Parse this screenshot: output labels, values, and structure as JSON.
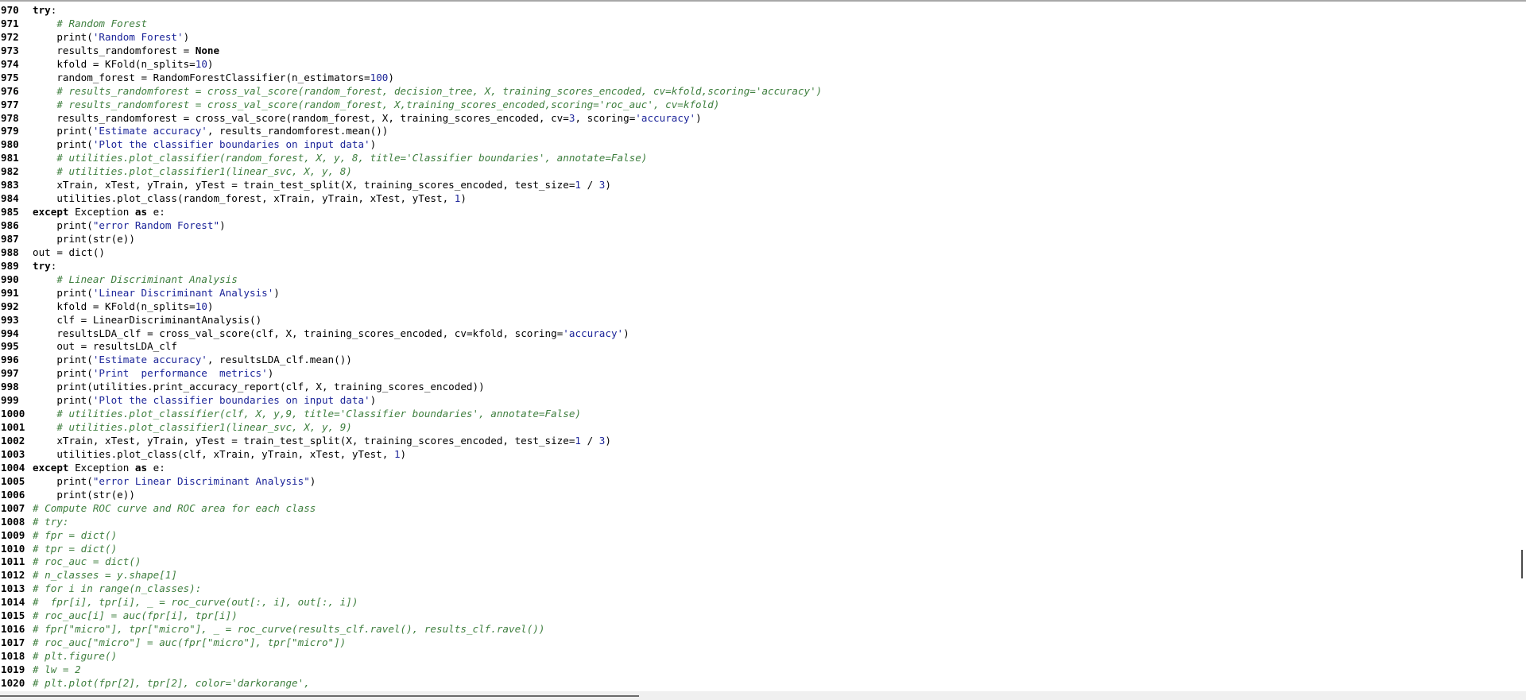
{
  "editor": {
    "lines": [
      {
        "n": "970",
        "t": [
          [
            "kw",
            "try"
          ],
          [
            "op",
            ":"
          ]
        ]
      },
      {
        "n": "971",
        "t": [
          [
            "plain",
            "    "
          ],
          [
            "cm",
            "# Random Forest"
          ]
        ]
      },
      {
        "n": "972",
        "t": [
          [
            "plain",
            "    print("
          ],
          [
            "str",
            "'Random Forest'"
          ],
          [
            "plain",
            ")"
          ]
        ]
      },
      {
        "n": "973",
        "t": [
          [
            "plain",
            "    results_randomforest "
          ],
          [
            "op",
            "="
          ],
          [
            "plain",
            " "
          ],
          [
            "kw",
            "None"
          ]
        ]
      },
      {
        "n": "974",
        "t": [
          [
            "plain",
            "    kfold "
          ],
          [
            "op",
            "="
          ],
          [
            "plain",
            " KFold(n_splits"
          ],
          [
            "op",
            "="
          ],
          [
            "num",
            "10"
          ],
          [
            "plain",
            ")"
          ]
        ]
      },
      {
        "n": "975",
        "t": [
          [
            "plain",
            "    random_forest "
          ],
          [
            "op",
            "="
          ],
          [
            "plain",
            " RandomForestClassifier(n_estimators"
          ],
          [
            "op",
            "="
          ],
          [
            "num",
            "100"
          ],
          [
            "plain",
            ")"
          ]
        ]
      },
      {
        "n": "976",
        "t": [
          [
            "plain",
            "    "
          ],
          [
            "cm",
            "# results_randomforest = cross_val_score(random_forest, decision_tree, X, training_scores_encoded, cv=kfold,scoring='accuracy')"
          ]
        ]
      },
      {
        "n": "977",
        "t": [
          [
            "plain",
            "    "
          ],
          [
            "cm",
            "# results_randomforest = cross_val_score(random_forest, X,training_scores_encoded,scoring='roc_auc', cv=kfold)"
          ]
        ]
      },
      {
        "n": "978",
        "t": [
          [
            "plain",
            "    results_randomforest "
          ],
          [
            "op",
            "="
          ],
          [
            "plain",
            " cross_val_score(random_forest, X, training_scores_encoded, cv"
          ],
          [
            "op",
            "="
          ],
          [
            "num",
            "3"
          ],
          [
            "plain",
            ", scoring"
          ],
          [
            "op",
            "="
          ],
          [
            "str",
            "'accuracy'"
          ],
          [
            "plain",
            ")"
          ]
        ]
      },
      {
        "n": "979",
        "t": [
          [
            "plain",
            "    print("
          ],
          [
            "str",
            "'Estimate accuracy'"
          ],
          [
            "plain",
            ", results_randomforest.mean())"
          ]
        ]
      },
      {
        "n": "980",
        "t": [
          [
            "plain",
            "    print("
          ],
          [
            "str",
            "'Plot the classifier boundaries on input data'"
          ],
          [
            "plain",
            ")"
          ]
        ]
      },
      {
        "n": "981",
        "t": [
          [
            "plain",
            "    "
          ],
          [
            "cm",
            "# utilities.plot_classifier(random_forest, X, y, 8, title='Classifier boundaries', annotate=False)"
          ]
        ]
      },
      {
        "n": "982",
        "t": [
          [
            "plain",
            "    "
          ],
          [
            "cm",
            "# utilities.plot_classifier1(linear_svc, X, y, 8)"
          ]
        ]
      },
      {
        "n": "983",
        "t": [
          [
            "plain",
            "    xTrain, xTest, yTrain, yTest "
          ],
          [
            "op",
            "="
          ],
          [
            "plain",
            " train_test_split(X, training_scores_encoded, test_size"
          ],
          [
            "op",
            "="
          ],
          [
            "num",
            "1"
          ],
          [
            "plain",
            " "
          ],
          [
            "op",
            "/"
          ],
          [
            "plain",
            " "
          ],
          [
            "num",
            "3"
          ],
          [
            "plain",
            ")"
          ]
        ]
      },
      {
        "n": "984",
        "t": [
          [
            "plain",
            "    utilities.plot_class(random_forest, xTrain, yTrain, xTest, yTest, "
          ],
          [
            "num",
            "1"
          ],
          [
            "plain",
            ")"
          ]
        ]
      },
      {
        "n": "985",
        "t": [
          [
            "kw",
            "except"
          ],
          [
            "plain",
            " Exception "
          ],
          [
            "kw",
            "as"
          ],
          [
            "plain",
            " e:"
          ]
        ]
      },
      {
        "n": "986",
        "t": [
          [
            "plain",
            "    print("
          ],
          [
            "str",
            "\"error Random Forest\""
          ],
          [
            "plain",
            ")"
          ]
        ]
      },
      {
        "n": "987",
        "t": [
          [
            "plain",
            "    print(str(e))"
          ]
        ]
      },
      {
        "n": "988",
        "t": [
          [
            "plain",
            "out "
          ],
          [
            "op",
            "="
          ],
          [
            "plain",
            " dict()"
          ]
        ]
      },
      {
        "n": "989",
        "t": [
          [
            "kw",
            "try"
          ],
          [
            "op",
            ":"
          ]
        ]
      },
      {
        "n": "990",
        "t": [
          [
            "plain",
            "    "
          ],
          [
            "cm",
            "# Linear Discriminant Analysis"
          ]
        ]
      },
      {
        "n": "991",
        "t": [
          [
            "plain",
            "    print("
          ],
          [
            "str",
            "'Linear Discriminant Analysis'"
          ],
          [
            "plain",
            ")"
          ]
        ]
      },
      {
        "n": "992",
        "t": [
          [
            "plain",
            "    kfold "
          ],
          [
            "op",
            "="
          ],
          [
            "plain",
            " KFold(n_splits"
          ],
          [
            "op",
            "="
          ],
          [
            "num",
            "10"
          ],
          [
            "plain",
            ")"
          ]
        ]
      },
      {
        "n": "993",
        "t": [
          [
            "plain",
            "    clf "
          ],
          [
            "op",
            "="
          ],
          [
            "plain",
            " LinearDiscriminantAnalysis()"
          ]
        ]
      },
      {
        "n": "994",
        "t": [
          [
            "plain",
            "    resultsLDA_clf "
          ],
          [
            "op",
            "="
          ],
          [
            "plain",
            " cross_val_score(clf, X, training_scores_encoded, cv"
          ],
          [
            "op",
            "="
          ],
          [
            "plain",
            "kfold, scoring"
          ],
          [
            "op",
            "="
          ],
          [
            "str",
            "'accuracy'"
          ],
          [
            "plain",
            ")"
          ]
        ]
      },
      {
        "n": "995",
        "t": [
          [
            "plain",
            "    out "
          ],
          [
            "op",
            "="
          ],
          [
            "plain",
            " resultsLDA_clf"
          ]
        ]
      },
      {
        "n": "996",
        "t": [
          [
            "plain",
            "    print("
          ],
          [
            "str",
            "'Estimate accuracy'"
          ],
          [
            "plain",
            ", resultsLDA_clf.mean())"
          ]
        ]
      },
      {
        "n": "997",
        "t": [
          [
            "plain",
            "    print("
          ],
          [
            "str",
            "'Print  performance  metrics'"
          ],
          [
            "plain",
            ")"
          ]
        ]
      },
      {
        "n": "998",
        "t": [
          [
            "plain",
            "    print(utilities.print_accuracy_report(clf, X, training_scores_encoded))"
          ]
        ]
      },
      {
        "n": "999",
        "t": [
          [
            "plain",
            "    print("
          ],
          [
            "str",
            "'Plot the classifier boundaries on input data'"
          ],
          [
            "plain",
            ")"
          ]
        ]
      },
      {
        "n": "1000",
        "t": [
          [
            "plain",
            "    "
          ],
          [
            "cm",
            "# utilities.plot_classifier(clf, X, y,9, title='Classifier boundaries', annotate=False)"
          ]
        ]
      },
      {
        "n": "1001",
        "t": [
          [
            "plain",
            "    "
          ],
          [
            "cm",
            "# utilities.plot_classifier1(linear_svc, X, y, 9)"
          ]
        ]
      },
      {
        "n": "1002",
        "t": [
          [
            "plain",
            "    xTrain, xTest, yTrain, yTest "
          ],
          [
            "op",
            "="
          ],
          [
            "plain",
            " train_test_split(X, training_scores_encoded, test_size"
          ],
          [
            "op",
            "="
          ],
          [
            "num",
            "1"
          ],
          [
            "plain",
            " "
          ],
          [
            "op",
            "/"
          ],
          [
            "plain",
            " "
          ],
          [
            "num",
            "3"
          ],
          [
            "plain",
            ")"
          ]
        ]
      },
      {
        "n": "1003",
        "t": [
          [
            "plain",
            "    utilities.plot_class(clf, xTrain, yTrain, xTest, yTest, "
          ],
          [
            "num",
            "1"
          ],
          [
            "plain",
            ")"
          ]
        ]
      },
      {
        "n": "1004",
        "t": [
          [
            "kw",
            "except"
          ],
          [
            "plain",
            " Exception "
          ],
          [
            "kw",
            "as"
          ],
          [
            "plain",
            " e:"
          ]
        ]
      },
      {
        "n": "1005",
        "t": [
          [
            "plain",
            "    print("
          ],
          [
            "str",
            "\"error Linear Discriminant Analysis\""
          ],
          [
            "plain",
            ")"
          ]
        ]
      },
      {
        "n": "1006",
        "t": [
          [
            "plain",
            "    print(str(e))"
          ]
        ]
      },
      {
        "n": "1007",
        "t": [
          [
            "cm",
            "# Compute ROC curve and ROC area for each class"
          ]
        ]
      },
      {
        "n": "1008",
        "t": [
          [
            "cm",
            "# try:"
          ]
        ]
      },
      {
        "n": "1009",
        "t": [
          [
            "cm",
            "# fpr = dict()"
          ]
        ]
      },
      {
        "n": "1010",
        "t": [
          [
            "cm",
            "# tpr = dict()"
          ]
        ]
      },
      {
        "n": "1011",
        "t": [
          [
            "cm",
            "# roc_auc = dict()"
          ]
        ]
      },
      {
        "n": "1012",
        "t": [
          [
            "cm",
            "# n_classes = y.shape[1]"
          ]
        ]
      },
      {
        "n": "1013",
        "t": [
          [
            "cm",
            "# for i in range(n_classes):"
          ]
        ]
      },
      {
        "n": "1014",
        "t": [
          [
            "cm",
            "#  fpr[i], tpr[i], _ = roc_curve(out[:, i], out[:, i])"
          ]
        ]
      },
      {
        "n": "1015",
        "t": [
          [
            "cm",
            "# roc_auc[i] = auc(fpr[i], tpr[i])"
          ]
        ]
      },
      {
        "n": "1016",
        "t": [
          [
            "cm",
            "# fpr[\"micro\"], tpr[\"micro\"], _ = roc_curve(results_clf.ravel(), results_clf.ravel())"
          ]
        ]
      },
      {
        "n": "1017",
        "t": [
          [
            "cm",
            "# roc_auc[\"micro\"] = auc(fpr[\"micro\"], tpr[\"micro\"])"
          ]
        ]
      },
      {
        "n": "1018",
        "t": [
          [
            "cm",
            "# plt.figure()"
          ]
        ]
      },
      {
        "n": "1019",
        "t": [
          [
            "cm",
            "# lw = 2"
          ]
        ]
      },
      {
        "n": "1020",
        "t": [
          [
            "cm",
            "# plt.plot(fpr[2], tpr[2], color='darkorange',"
          ]
        ]
      }
    ]
  },
  "colors": {
    "keyword": "#000000",
    "comment": "#3f7f3f",
    "string": "#1c2599",
    "number": "#1c2599",
    "background": "#ffffff"
  }
}
